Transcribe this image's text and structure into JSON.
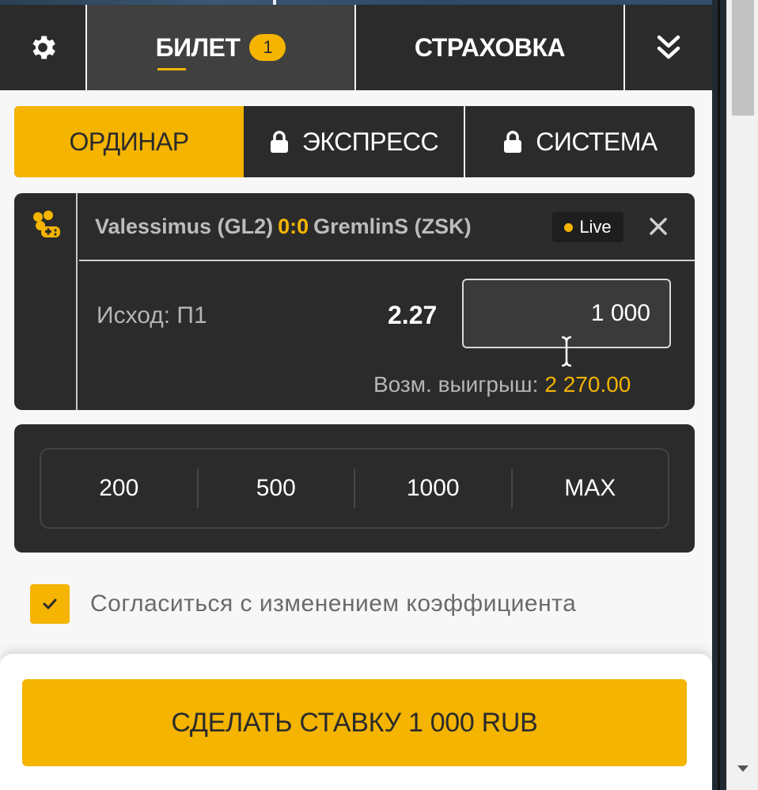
{
  "header": {
    "settings_icon": "gear-icon",
    "ticket_label": "БИЛЕТ",
    "ticket_count": "1",
    "insurance_label": "СТРАХОВКА",
    "collapse_icon": "double-chevron-down-icon"
  },
  "bet_types": {
    "single": "ОРДИНАР",
    "express": "ЭКСПРЕСС",
    "system": "СИСТЕМА",
    "lock_icon": "lock-icon"
  },
  "bet": {
    "sport_icon": "gamepad-icon",
    "team1": "Valessimus (GL2)",
    "score": "0:0",
    "team2": "GremlinS (ZSK)",
    "live_label": "Live",
    "outcome": "Исход: П1",
    "odds": "2.27",
    "stake": "1 000",
    "possible_win_label": "Возм. выигрыш:",
    "possible_win_value": "2 270.00"
  },
  "quick_amounts": [
    "200",
    "500",
    "1000",
    "MAX"
  ],
  "agree_label": "Согласиться с изменением коэффициента",
  "submit_label": "СДЕЛАТЬ СТАВКУ 1 000 RUB",
  "colors": {
    "accent": "#f4b400",
    "dark": "#2b2b2b",
    "panel": "#f7f7f7"
  }
}
